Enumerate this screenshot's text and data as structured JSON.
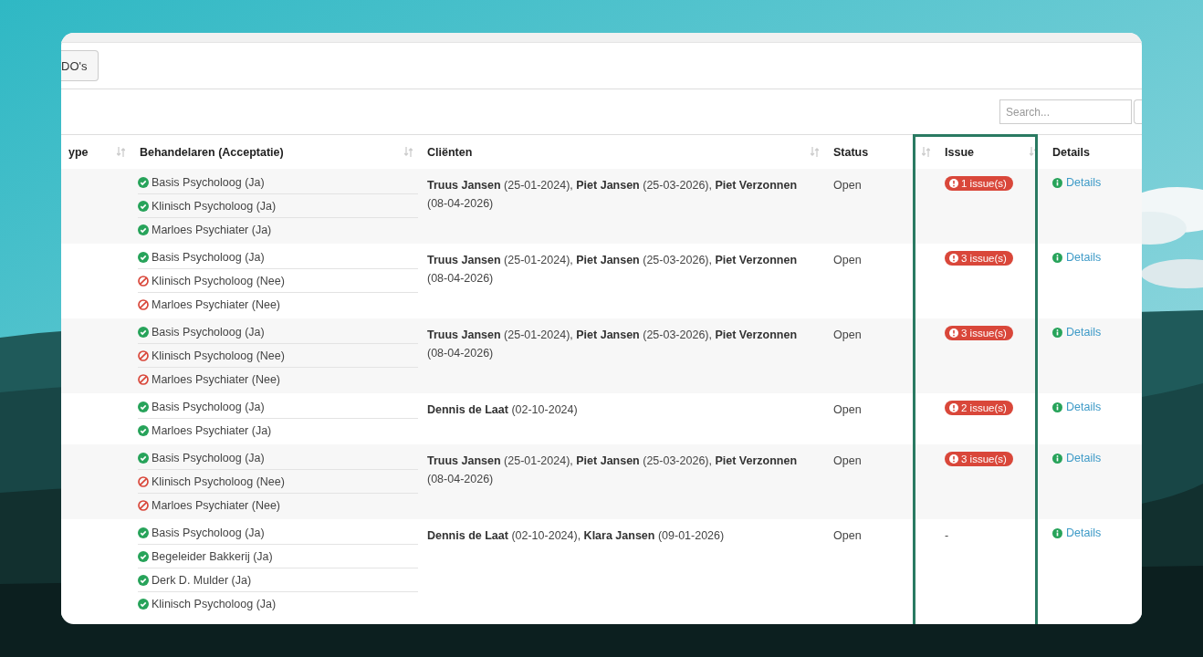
{
  "toolbar": {
    "button": "DO's"
  },
  "search": {
    "placeholder": "Search..."
  },
  "table": {
    "columns": [
      {
        "label": "ype",
        "sortable": true
      },
      {
        "label": "Behandelaren (Acceptatie)",
        "sortable": true
      },
      {
        "label": "Cliënten",
        "sortable": true
      },
      {
        "label": "Status",
        "sortable": true
      },
      {
        "label": "Issue",
        "sortable": true
      },
      {
        "label": "Details",
        "sortable": false
      }
    ],
    "rows": [
      {
        "behandelaren": [
          {
            "label": "Basis Psycholoog (Ja)",
            "accepted": true
          },
          {
            "label": "Klinisch Psycholoog (Ja)",
            "accepted": true
          },
          {
            "label": "Marloes Psychiater (Ja)",
            "accepted": true
          }
        ],
        "clienten": "**Truus Jansen** (25-01-2024), **Piet Jansen** (25-03-2026), **Piet Verzonnen** (08-04-2026)",
        "status": "Open",
        "issue": {
          "kind": "badge",
          "label": "1 issue(s)"
        },
        "details": "Details"
      },
      {
        "behandelaren": [
          {
            "label": "Basis Psycholoog (Ja)",
            "accepted": true
          },
          {
            "label": "Klinisch Psycholoog (Nee)",
            "accepted": false
          },
          {
            "label": "Marloes Psychiater (Nee)",
            "accepted": false
          }
        ],
        "clienten": "**Truus Jansen** (25-01-2024), **Piet Jansen** (25-03-2026), **Piet Verzonnen** (08-04-2026)",
        "status": "Open",
        "issue": {
          "kind": "badge",
          "label": "3 issue(s)"
        },
        "details": "Details"
      },
      {
        "behandelaren": [
          {
            "label": "Basis Psycholoog (Ja)",
            "accepted": true
          },
          {
            "label": "Klinisch Psycholoog (Nee)",
            "accepted": false
          },
          {
            "label": "Marloes Psychiater (Nee)",
            "accepted": false
          }
        ],
        "clienten": "**Truus Jansen** (25-01-2024), **Piet Jansen** (25-03-2026), **Piet Verzonnen** (08-04-2026)",
        "status": "Open",
        "issue": {
          "kind": "badge",
          "label": "3 issue(s)"
        },
        "details": "Details"
      },
      {
        "behandelaren": [
          {
            "label": "Basis Psycholoog (Ja)",
            "accepted": true
          },
          {
            "label": "Marloes Psychiater (Ja)",
            "accepted": true
          }
        ],
        "clienten": "**Dennis de Laat** (02-10-2024)",
        "status": "Open",
        "issue": {
          "kind": "badge",
          "label": "2 issue(s)"
        },
        "details": "Details"
      },
      {
        "behandelaren": [
          {
            "label": "Basis Psycholoog (Ja)",
            "accepted": true
          },
          {
            "label": "Klinisch Psycholoog (Nee)",
            "accepted": false
          },
          {
            "label": "Marloes Psychiater (Nee)",
            "accepted": false
          }
        ],
        "clienten": "**Truus Jansen** (25-01-2024), **Piet Jansen** (25-03-2026), **Piet Verzonnen** (08-04-2026)",
        "status": "Open",
        "issue": {
          "kind": "badge",
          "label": "3 issue(s)"
        },
        "details": "Details"
      },
      {
        "behandelaren": [
          {
            "label": "Basis Psycholoog (Ja)",
            "accepted": true
          },
          {
            "label": "Begeleider Bakkerij (Ja)",
            "accepted": true
          },
          {
            "label": "Derk D. Mulder (Ja)",
            "accepted": true
          },
          {
            "label": "Klinisch Psycholoog (Ja)",
            "accepted": true
          }
        ],
        "clienten": "**Dennis de Laat** (02-10-2024), **Klara Jansen** (09-01-2026)",
        "status": "Open",
        "issue": {
          "kind": "none",
          "label": "-"
        },
        "details": "Details"
      }
    ]
  }
}
